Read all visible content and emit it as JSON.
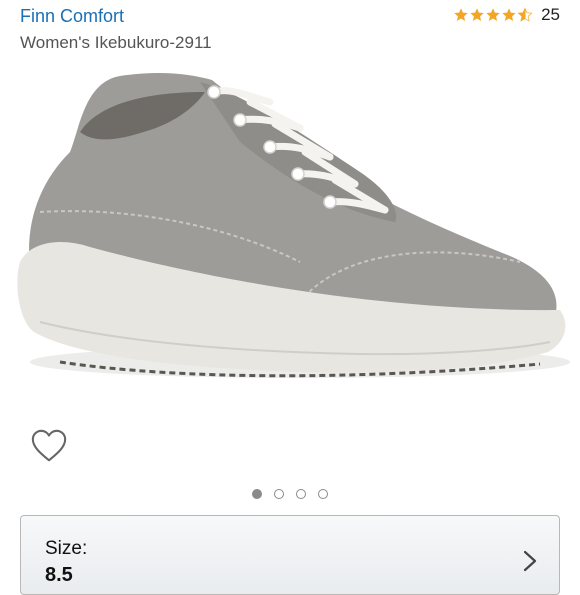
{
  "header": {
    "brand": "Finn Comfort",
    "title": "Women's Ikebukuro-2911",
    "rating": {
      "stars": 4.5,
      "count": "25",
      "star_color": "#f2a626"
    }
  },
  "image": {
    "icon": "shoe-photo",
    "shoe_color": "#9c9a96",
    "sole_color": "#e8e6e1",
    "lace_color": "#f4f3ef"
  },
  "carousel": {
    "total": 4,
    "active": 1
  },
  "wishlist": {
    "icon": "heart-outline-icon"
  },
  "size_selector": {
    "label": "Size:",
    "value": "8.5",
    "icon": "chevron-right-icon"
  }
}
